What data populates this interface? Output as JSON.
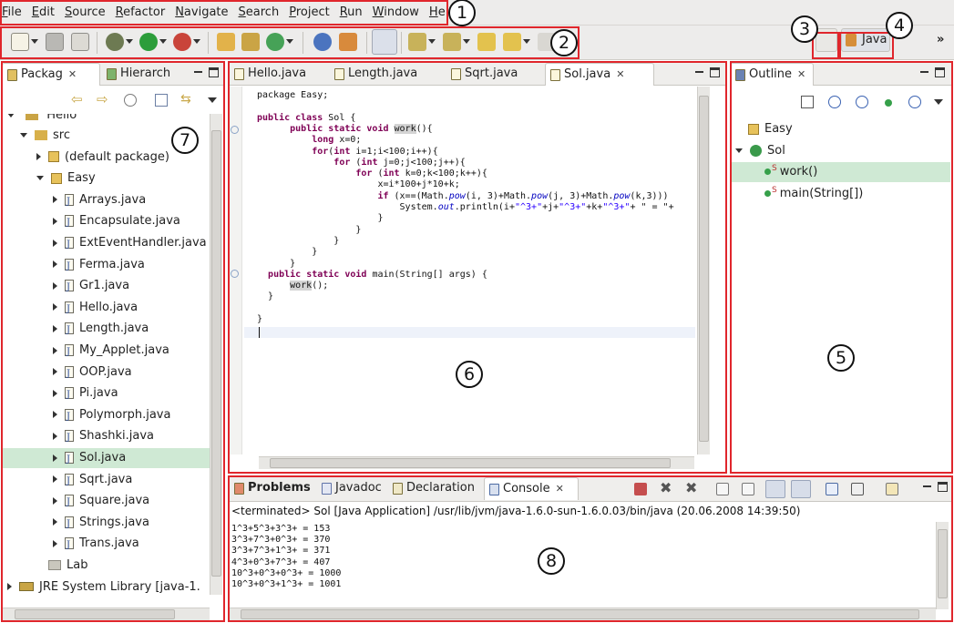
{
  "menu": [
    "File",
    "Edit",
    "Source",
    "Refactor",
    "Navigate",
    "Search",
    "Project",
    "Run",
    "Window",
    "Help"
  ],
  "perspective": {
    "label": "Java"
  },
  "callouts": [
    "1",
    "2",
    "3",
    "4",
    "5",
    "6",
    "7",
    "8"
  ],
  "package_explorer": {
    "tabs": [
      "Packag",
      "Hierarch"
    ],
    "top_cut_label": "Hello",
    "items": [
      {
        "label": "src",
        "level": 1,
        "expand": "open",
        "icon": "package-folder-icon"
      },
      {
        "label": "(default package)",
        "level": 2,
        "expand": "closed",
        "icon": "package-icon"
      },
      {
        "label": "Easy",
        "level": 2,
        "expand": "open",
        "icon": "package-icon"
      },
      {
        "label": "Arrays.java",
        "level": 3,
        "expand": "closed",
        "icon": "java-file-icon"
      },
      {
        "label": "Encapsulate.java",
        "level": 3,
        "expand": "closed",
        "icon": "java-file-icon"
      },
      {
        "label": "ExtEventHandler.java",
        "level": 3,
        "expand": "closed",
        "icon": "java-file-icon"
      },
      {
        "label": "Ferma.java",
        "level": 3,
        "expand": "closed",
        "icon": "java-file-icon"
      },
      {
        "label": "Gr1.java",
        "level": 3,
        "expand": "closed",
        "icon": "java-file-icon"
      },
      {
        "label": "Hello.java",
        "level": 3,
        "expand": "closed",
        "icon": "java-file-icon"
      },
      {
        "label": "Length.java",
        "level": 3,
        "expand": "closed",
        "icon": "java-file-icon"
      },
      {
        "label": "My_Applet.java",
        "level": 3,
        "expand": "closed",
        "icon": "java-file-icon"
      },
      {
        "label": "OOP.java",
        "level": 3,
        "expand": "closed",
        "icon": "java-file-icon"
      },
      {
        "label": "Pi.java",
        "level": 3,
        "expand": "closed",
        "icon": "java-file-icon"
      },
      {
        "label": "Polymorph.java",
        "level": 3,
        "expand": "closed",
        "icon": "java-file-icon"
      },
      {
        "label": "Shashki.java",
        "level": 3,
        "expand": "closed",
        "icon": "java-file-icon"
      },
      {
        "label": "Sol.java",
        "level": 3,
        "expand": "closed",
        "icon": "java-file-icon",
        "selected": true
      },
      {
        "label": "Sqrt.java",
        "level": 3,
        "expand": "closed",
        "icon": "java-file-icon"
      },
      {
        "label": "Square.java",
        "level": 3,
        "expand": "closed",
        "icon": "java-file-icon"
      },
      {
        "label": "Strings.java",
        "level": 3,
        "expand": "closed",
        "icon": "java-file-icon"
      },
      {
        "label": "Trans.java",
        "level": 3,
        "expand": "closed",
        "icon": "java-file-icon"
      },
      {
        "label": "Lab",
        "level": 2,
        "expand": "none",
        "icon": "folder-icon"
      },
      {
        "label": "JRE System Library [java-1.",
        "level": 0,
        "expand": "closed",
        "icon": "library-icon"
      }
    ]
  },
  "editor": {
    "tabs": [
      {
        "label": "Hello.java",
        "active": false
      },
      {
        "label": "Length.java",
        "active": false
      },
      {
        "label": "Sqrt.java",
        "active": false
      },
      {
        "label": "Sol.java",
        "active": true
      }
    ],
    "code_lines": [
      [
        [
          "plain",
          "package Easy;"
        ]
      ],
      [],
      [
        [
          "kw",
          "public class "
        ],
        [
          "plain",
          "Sol {"
        ]
      ],
      [
        [
          "plain",
          "      "
        ],
        [
          "kw",
          "public static void "
        ],
        [
          "hl",
          "work"
        ],
        [
          "plain",
          "(){"
        ]
      ],
      [
        [
          "plain",
          "          "
        ],
        [
          "kw",
          "long "
        ],
        [
          "plain",
          "x=0;"
        ]
      ],
      [
        [
          "plain",
          "          "
        ],
        [
          "kw",
          "for"
        ],
        [
          "plain",
          "("
        ],
        [
          "kw",
          "int "
        ],
        [
          "plain",
          "i=1;i<100;i++){"
        ]
      ],
      [
        [
          "plain",
          "              "
        ],
        [
          "kw",
          "for "
        ],
        [
          "plain",
          "("
        ],
        [
          "kw",
          "int "
        ],
        [
          "plain",
          "j=0;j<100;j++){"
        ]
      ],
      [
        [
          "plain",
          "                  "
        ],
        [
          "kw",
          "for "
        ],
        [
          "plain",
          "("
        ],
        [
          "kw",
          "int "
        ],
        [
          "plain",
          "k=0;k<100;k++){"
        ]
      ],
      [
        [
          "plain",
          "                      x=i*100+j*10+k;"
        ]
      ],
      [
        [
          "plain",
          "                      "
        ],
        [
          "kw",
          "if "
        ],
        [
          "plain",
          "(x==(Math."
        ],
        [
          "fld",
          "pow"
        ],
        [
          "plain",
          "(i, 3)+Math."
        ],
        [
          "fld",
          "pow"
        ],
        [
          "plain",
          "(j, 3)+Math."
        ],
        [
          "fld",
          "pow"
        ],
        [
          "plain",
          "(k,3)))"
        ]
      ],
      [
        [
          "plain",
          "                          System."
        ],
        [
          "fld",
          "out"
        ],
        [
          "plain",
          ".println(i+"
        ],
        [
          "str",
          "\"^3+\""
        ],
        [
          "plain",
          "+j+"
        ],
        [
          "str",
          "\"^3+\""
        ],
        [
          "plain",
          "+k+"
        ],
        [
          "str",
          "\"^3+\""
        ],
        [
          "plain",
          "+ \" = \"+"
        ]
      ],
      [
        [
          "plain",
          "                      }"
        ]
      ],
      [
        [
          "plain",
          "                  }"
        ]
      ],
      [
        [
          "plain",
          "              }"
        ]
      ],
      [
        [
          "plain",
          "          }"
        ]
      ],
      [
        [
          "plain",
          "      }"
        ]
      ],
      [
        [
          "plain",
          "  "
        ],
        [
          "kw",
          "public static void "
        ],
        [
          "plain",
          "main(String[] args) {"
        ]
      ],
      [
        [
          "plain",
          "      "
        ],
        [
          "hl",
          "work"
        ],
        [
          "plain",
          "();"
        ]
      ],
      [
        [
          "plain",
          "  }"
        ]
      ],
      [],
      [
        [
          "plain",
          "}"
        ]
      ]
    ]
  },
  "outline": {
    "tab": "Outline",
    "items": [
      {
        "label": "Easy",
        "icon": "package-icon",
        "level": 0
      },
      {
        "label": "Sol",
        "icon": "class-icon",
        "level": 0,
        "expand": "open"
      },
      {
        "label": "work()",
        "icon": "method-icon",
        "level": 1,
        "modifier": "S",
        "selected": true
      },
      {
        "label": "main(String[])",
        "icon": "method-icon",
        "level": 1,
        "modifier": "S"
      }
    ]
  },
  "bottom": {
    "tabs": [
      "Problems",
      "Javadoc",
      "Declaration",
      "Console"
    ],
    "active_tab": "Console",
    "status": "<terminated> Sol [Java Application] /usr/lib/jvm/java-1.6.0-sun-1.6.0.03/bin/java (20.06.2008 14:39:50)",
    "console_lines": [
      "1^3+5^3+3^3+ = 153",
      "3^3+7^3+0^3+ = 370",
      "3^3+7^3+1^3+ = 371",
      "4^3+0^3+7^3+ = 407",
      "10^3+0^3+0^3+ = 1000",
      "10^3+0^3+1^3+ = 1001"
    ]
  },
  "colors": {
    "annotation": "#e0262c",
    "selection": "#cfe9d4",
    "keyword": "#7f0055",
    "string": "#2a00ff",
    "panel_bg": "#efeeec"
  }
}
